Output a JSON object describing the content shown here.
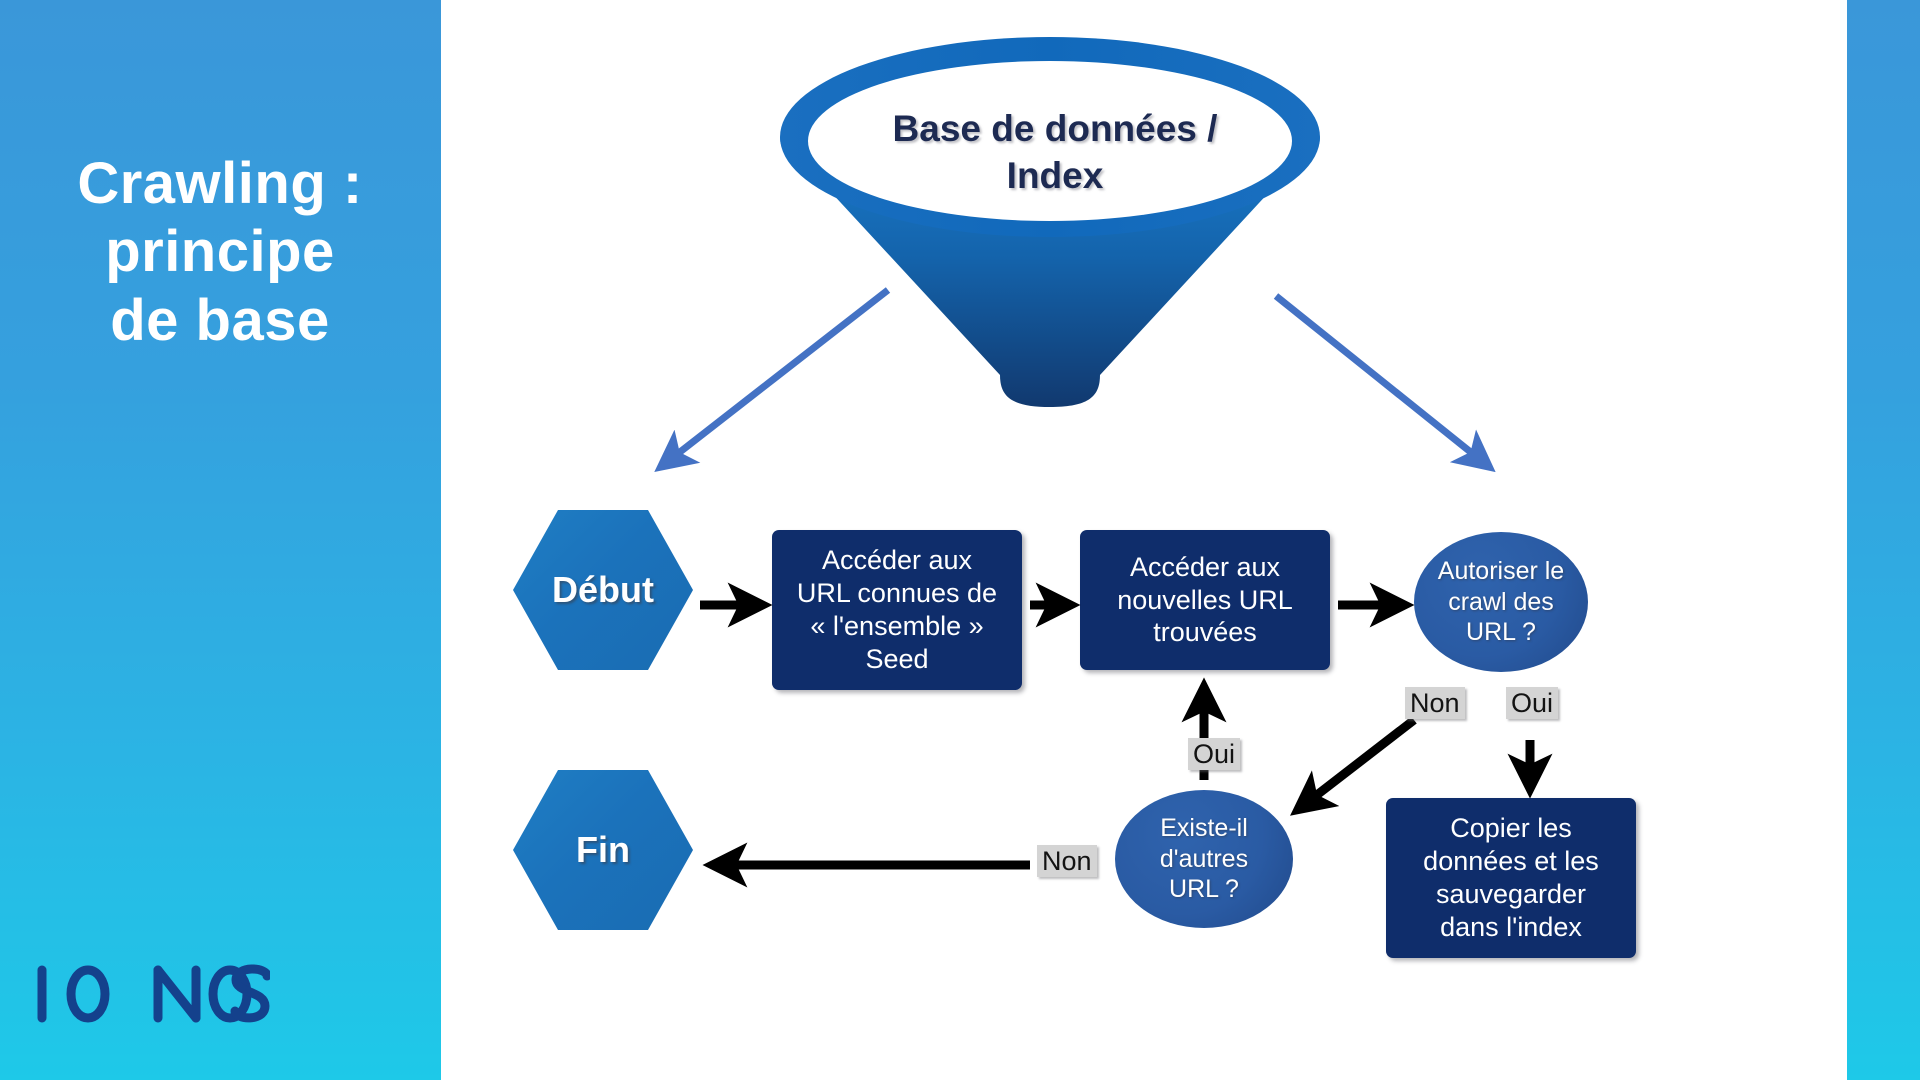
{
  "slide": {
    "title": "Crawling :\nprincipe\nde base",
    "brand_logo": "IONOS",
    "sidebar_gradient_top": "#3a97d9",
    "sidebar_gradient_bottom": "#1ec9e8",
    "background": "#ffffff"
  },
  "diagram": {
    "funnel": {
      "label": "Base de données /\nIndex",
      "rim_color": "#1668b8",
      "body_color_top": "#1572bf",
      "body_color_bottom": "#123c77",
      "interior_color": "#ffffff",
      "text_color": "#1d2a52"
    },
    "funnel_arrow_color": "#4472c4",
    "flow_arrow_color": "#000000",
    "nodes": [
      {
        "id": "debut",
        "type": "hexagon",
        "label": "Début"
      },
      {
        "id": "seed",
        "type": "process",
        "label": "Accéder aux\nURL connues de\n« l'ensemble »\nSeed"
      },
      {
        "id": "nouvelles",
        "type": "process",
        "label": "Accéder aux\nnouvelles URL\ntrouvées"
      },
      {
        "id": "autoriser",
        "type": "decision",
        "label": "Autoriser le\ncrawl des\nURL ?"
      },
      {
        "id": "copier",
        "type": "process",
        "label": "Copier les\ndonnées et les\nsauvegarder\ndans l'index"
      },
      {
        "id": "existe",
        "type": "decision",
        "label": "Existe-il\nd'autres\nURL ?"
      },
      {
        "id": "fin",
        "type": "hexagon",
        "label": "Fin"
      }
    ],
    "edge_labels": {
      "autoriser_non": "Non",
      "autoriser_oui": "Oui",
      "existe_oui": "Oui",
      "existe_non": "Non"
    }
  }
}
